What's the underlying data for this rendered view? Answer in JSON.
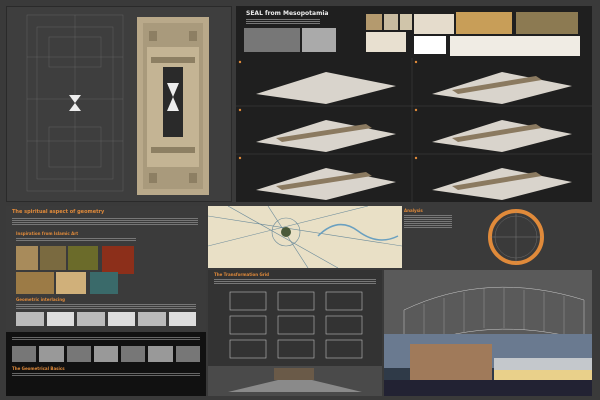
{
  "top_right": {
    "title": "SEAL from Mesopotamia"
  },
  "middle_left": {
    "title": "The spiritual aspect of geometry",
    "subtitle": "Inspiration from Islamic Art",
    "section": "Geometric interlacing"
  },
  "bottom_left": {
    "title": "The Geometrical Basics"
  },
  "bottom_center": {
    "title": "The Transformation Grid"
  },
  "middle_right": {
    "title": "Analysis"
  },
  "colors": {
    "accent": "#e08a3a",
    "panel_dark": "#1f1f1f",
    "panel_mid": "#3b3b3b",
    "map_bg": "#e9e0c6"
  }
}
